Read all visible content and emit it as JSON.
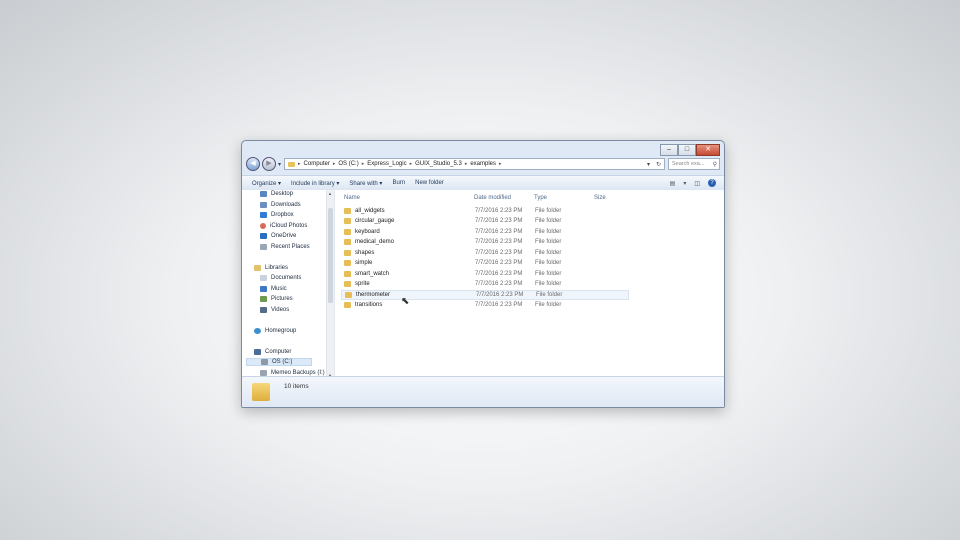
{
  "window": {
    "controls": {
      "minimize": "–",
      "maximize": "□",
      "close": "✕"
    }
  },
  "address": {
    "back": "◀",
    "forward": "▶",
    "dropdown": "▾",
    "crumbs": [
      "Computer",
      "OS (C:)",
      "Express_Logic",
      "GUIX_Studio_5.3",
      "examples"
    ],
    "separator": "▸",
    "history_dropdown": "▾",
    "refresh": "↻",
    "search_placeholder": "Search exa...",
    "search_icon": "⚲"
  },
  "toolbar": {
    "organize": "Organize ▾",
    "include": "Include in library ▾",
    "share": "Share with ▾",
    "burn": "Burn",
    "new_folder": "New folder",
    "view": "▤",
    "view_drop": "▾",
    "preview": "◫",
    "help": "?"
  },
  "nav": {
    "items": [
      "Desktop",
      "Downloads",
      "Dropbox",
      "iCloud Photos",
      "OneDrive",
      "Recent Places"
    ],
    "libraries": "Libraries",
    "library_items": [
      "Documents",
      "Music",
      "Pictures",
      "Videos"
    ],
    "homegroup": "Homegroup",
    "computer": "Computer",
    "drives": [
      "OS (C:)",
      "Memeo Backups (I:)"
    ],
    "scroll_up": "▲",
    "scroll_down": "▼"
  },
  "columns": {
    "name": "Name",
    "date": "Date modified",
    "type": "Type",
    "size": "Size"
  },
  "files": [
    {
      "name": "all_widgets",
      "date": "7/7/2016 2:23 PM",
      "type": "File folder"
    },
    {
      "name": "circular_gauge",
      "date": "7/7/2016 2:23 PM",
      "type": "File folder"
    },
    {
      "name": "keyboard",
      "date": "7/7/2016 2:23 PM",
      "type": "File folder"
    },
    {
      "name": "medical_demo",
      "date": "7/7/2016 2:23 PM",
      "type": "File folder"
    },
    {
      "name": "shapes",
      "date": "7/7/2016 2:23 PM",
      "type": "File folder"
    },
    {
      "name": "simple",
      "date": "7/7/2016 2:23 PM",
      "type": "File folder"
    },
    {
      "name": "smart_watch",
      "date": "7/7/2016 2:23 PM",
      "type": "File folder"
    },
    {
      "name": "sprite",
      "date": "7/7/2016 2:23 PM",
      "type": "File folder"
    },
    {
      "name": "thermometer",
      "date": "7/7/2016 2:23 PM",
      "type": "File folder"
    },
    {
      "name": "transitions",
      "date": "7/7/2016 2:23 PM",
      "type": "File folder"
    }
  ],
  "details": {
    "count": "10 items"
  },
  "cursor": "⬉",
  "colors": {
    "folder": "#e6be55",
    "accent": "#2a5fb0"
  }
}
